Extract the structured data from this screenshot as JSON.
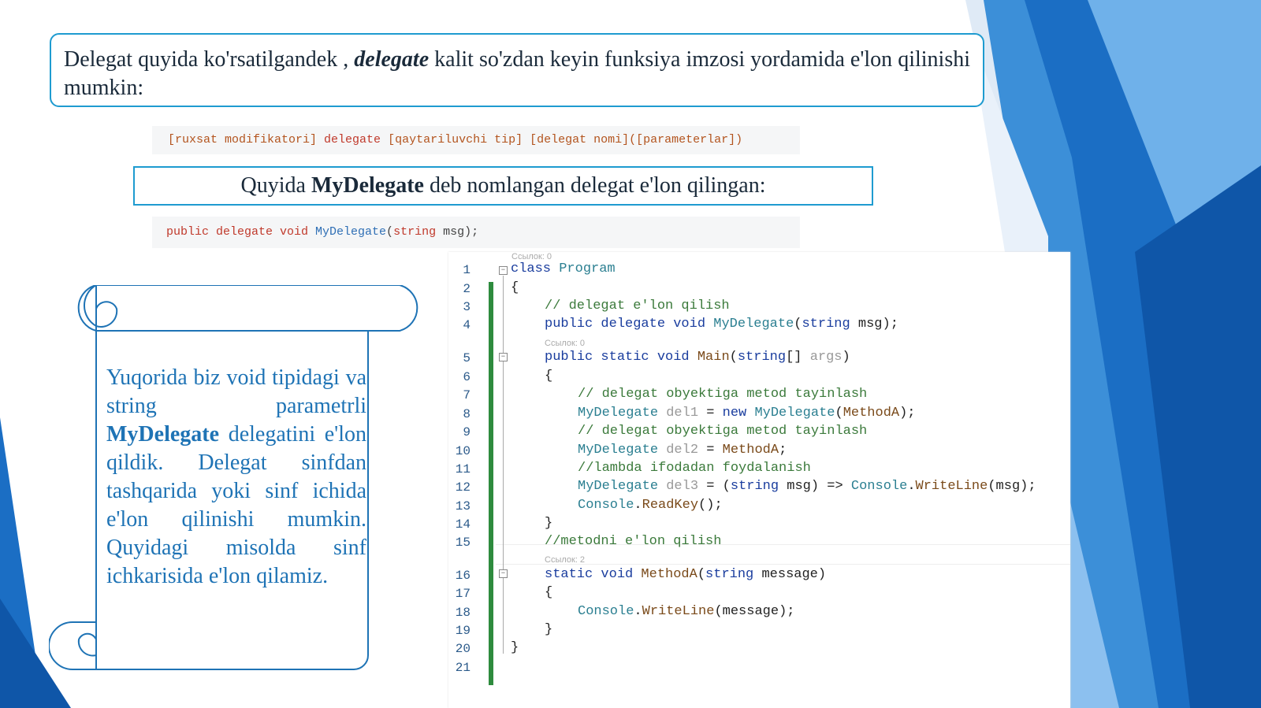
{
  "callout_top": {
    "text_pre": "Delegat quyida ko'rsatilgandek , ",
    "text_em": "delegate",
    "text_post": " kalit so'zdan keyin funksiya imzosi yordamida e'lon qilinishi mumkin:"
  },
  "syntax": {
    "p1": "[ruxsat modifikatori] ",
    "kw": "delegate",
    "p2": " [qaytariluvchi tip] [delegat nomi]([parameterlar])"
  },
  "callout_mid": {
    "pre": "Quyida ",
    "bold": "MyDelegate",
    "post": " deb nomlangan delegat e'lon qilingan:"
  },
  "decl": {
    "kw1": "public delegate void ",
    "name": "MyDelegate",
    "open": "(",
    "kw2": "string",
    "rest": " msg);"
  },
  "scroll": {
    "t1": "Yuqorida biz void tipidagi va string parametrli ",
    "bold": "MyDelegate",
    "t2": " delegatini e'lon qildik. Delegat sinfdan tashqarida yoki sinf ichida e'lon qilinishi mumkin. Quyidagi misolda sinf ichkarisida e'lon qilamiz."
  },
  "editor": {
    "ref0": "Ссылок: 0",
    "ref1": "Ссылок: 0",
    "ref2": "Ссылок: 2",
    "line_numbers": [
      "1",
      "2",
      "3",
      "4",
      "5",
      "6",
      "7",
      "8",
      "9",
      "10",
      "11",
      "12",
      "13",
      "14",
      "15",
      "16",
      "17",
      "18",
      "19",
      "20",
      "21"
    ],
    "l1_kw": "class ",
    "l1_t": "Program",
    "l2": "{",
    "l3": "// delegat e'lon qilish",
    "l4_kw": "public delegate void ",
    "l4_t": "MyDelegate",
    "l4_a": "(",
    "l4_kw2": "string",
    "l4_b": " msg);",
    "l5_kw": "public static void ",
    "l5_m": "Main",
    "l5_a": "(",
    "l5_kw2": "string",
    "l5_b": "[] ",
    "l5_p": "args",
    "l5_c": ")",
    "l6": "{",
    "l7": "// delegat obyektiga metod tayinlash",
    "l8_t": "MyDelegate ",
    "l8_p": "del1",
    "l8_a": " = ",
    "l8_kw": "new ",
    "l8_t2": "MyDelegate",
    "l8_b": "(",
    "l8_m": "MethodA",
    "l8_c": ");",
    "l9": "// delegat obyektiga metod tayinlash",
    "l10_t": "MyDelegate ",
    "l10_p": "del2",
    "l10_a": " = ",
    "l10_m": "MethodA",
    "l10_b": ";",
    "l11": "//lambda ifodadan foydalanish",
    "l12_t": "MyDelegate ",
    "l12_p": "del3",
    "l12_a": " = (",
    "l12_kw": "string",
    "l12_b": " msg) => ",
    "l12_t2": "Console",
    "l12_c": ".",
    "l12_m": "WriteLine",
    "l12_d": "(msg);",
    "l13_t": "Console",
    "l13_a": ".",
    "l13_m": "ReadKey",
    "l13_b": "();",
    "l14": "}",
    "l15": "//metodni e'lon qilish",
    "l16_kw": "static void ",
    "l16_m": "MethodA",
    "l16_a": "(",
    "l16_kw2": "string",
    "l16_b": " message)",
    "l17": "{",
    "l18_t": "Console",
    "l18_a": ".",
    "l18_m": "WriteLine",
    "l18_b": "(message);",
    "l19": "}",
    "l20": "}"
  },
  "colors": {
    "accent": "#1e9bd0",
    "scroll_text": "#1e73b5",
    "gutter_green": "#2e8b3e"
  }
}
